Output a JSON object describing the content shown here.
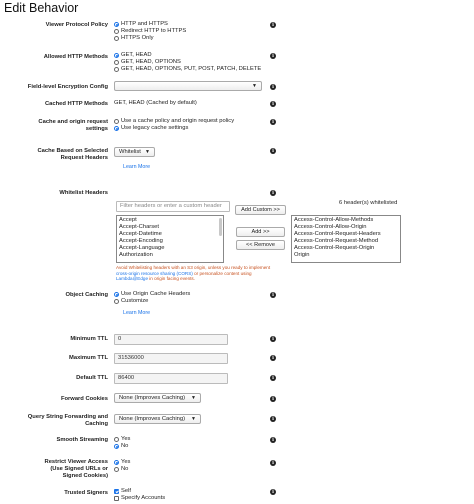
{
  "page_title": "Edit Behavior",
  "viewer_protocol_policy": {
    "label": "Viewer Protocol Policy",
    "options": [
      "HTTP and HTTPS",
      "Redirect HTTP to HTTPS",
      "HTTPS Only"
    ],
    "selected": 0
  },
  "allowed_http_methods": {
    "label": "Allowed HTTP Methods",
    "options": [
      "GET, HEAD",
      "GET, HEAD, OPTIONS",
      "GET, HEAD, OPTIONS, PUT, POST, PATCH, DELETE"
    ],
    "selected": 0
  },
  "field_level_encryption": {
    "label": "Field-level Encryption Config",
    "value": ""
  },
  "cached_http_methods": {
    "label": "Cached HTTP Methods",
    "value": "GET, HEAD (Cached by default)"
  },
  "cache_origin_settings": {
    "label_line1": "Cache and origin request",
    "label_line2": "settings",
    "options": [
      "Use a cache policy and origin request policy",
      "Use legacy cache settings"
    ],
    "selected": 1
  },
  "cache_based_headers": {
    "label_line1": "Cache Based on Selected",
    "label_line2": "Request Headers",
    "value": "Whitelist",
    "learn_more": "Learn More"
  },
  "whitelist_headers": {
    "label": "Whitelist Headers",
    "filter_placeholder": "Filter headers or enter a custom header",
    "add_custom": "Add Custom >>",
    "add": "Add >>",
    "remove": "<< Remove",
    "count_text": "6 header(s) whitelisted",
    "available": [
      "Accept",
      "Accept-Charset",
      "Accept-Datetime",
      "Accept-Encoding",
      "Accept-Language",
      "Authorization"
    ],
    "whitelisted": [
      "Access-Control-Allow-Methods",
      "Access-Control-Allow-Origin",
      "Access-Control-Request-Headers",
      "Access-Control-Request-Method",
      "Access-Control-Request-Origin",
      "Origin"
    ],
    "warning_pre": "Avoid Whitelisting headers with an S3 origin, unless you ready to implement ",
    "warning_link1": "cross-origin resource sharing (CORS)",
    "warning_mid": " or personalize content using ",
    "warning_link2": "Lambda@Edge",
    "warning_post": " in origin facing events."
  },
  "object_caching": {
    "label": "Object Caching",
    "options": [
      "Use Origin Cache Headers",
      "Customize"
    ],
    "selected": 0,
    "learn_more": "Learn More"
  },
  "minimum_ttl": {
    "label": "Minimum TTL",
    "value": "0"
  },
  "maximum_ttl": {
    "label": "Maximum TTL",
    "value": "31536000"
  },
  "default_ttl": {
    "label": "Default TTL",
    "value": "86400"
  },
  "forward_cookies": {
    "label": "Forward Cookies",
    "value": "None (Improves Caching)"
  },
  "query_string": {
    "label_line1": "Query String Forwarding and",
    "label_line2": "Caching",
    "value": "None (Improves Caching)"
  },
  "smooth_streaming": {
    "label": "Smooth Streaming",
    "options": [
      "Yes",
      "No"
    ],
    "selected": 1
  },
  "restrict_viewer_access": {
    "label_line1": "Restrict Viewer Access",
    "label_line2": "(Use Signed URLs or",
    "label_line3": "Signed Cookies)",
    "options": [
      "Yes",
      "No"
    ],
    "selected": 0
  },
  "trusted_signers": {
    "label": "Trusted Signers",
    "options": [
      "Self",
      "Specify Accounts"
    ],
    "checked": [
      true,
      false
    ]
  },
  "icons": {
    "info": "info-icon",
    "dropdown": "chevron-down-icon"
  },
  "colors": {
    "accent": "#1a73e8",
    "warning": "#c7511f"
  }
}
